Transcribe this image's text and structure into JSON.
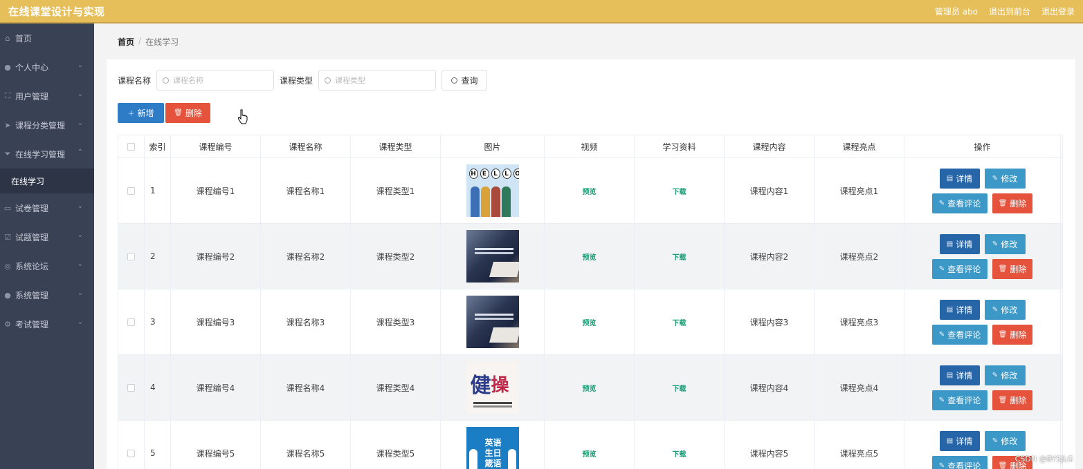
{
  "header": {
    "title": "在线课堂设计与实现",
    "admin": "管理员 abo",
    "back_front": "退出到前台",
    "logout": "退出登录"
  },
  "sidebar": {
    "items": [
      {
        "label": "首页",
        "icon": "home-icon"
      },
      {
        "label": "个人中心",
        "icon": "user-icon"
      },
      {
        "label": "用户管理",
        "icon": "frame-icon"
      },
      {
        "label": "课程分类管理",
        "icon": "send-icon"
      },
      {
        "label": "在线学习管理",
        "icon": "funnel-icon"
      },
      {
        "label": "试卷管理",
        "icon": "message-icon"
      },
      {
        "label": "试题管理",
        "icon": "check-box-icon"
      },
      {
        "label": "系统论坛",
        "icon": "compass-icon"
      },
      {
        "label": "系统管理",
        "icon": "user-icon"
      },
      {
        "label": "考试管理",
        "icon": "gear-icon"
      }
    ],
    "sub_item": "在线学习"
  },
  "breadcrumb": {
    "home": "首页",
    "sep": "/",
    "current": "在线学习"
  },
  "search": {
    "name_label": "课程名称",
    "name_placeholder": "课程名称",
    "type_label": "课程类型",
    "type_placeholder": "课程类型",
    "query_button": "查询"
  },
  "actions": {
    "add": "新增",
    "delete": "删除"
  },
  "table": {
    "headers": [
      "索引",
      "课程编号",
      "课程名称",
      "课程类型",
      "图片",
      "视频",
      "学习资料",
      "课程内容",
      "课程亮点",
      "操作"
    ],
    "rows": [
      {
        "index": "1",
        "code": "课程编号1",
        "name": "课程名称1",
        "type": "课程类型1",
        "video": "预览",
        "material": "下载",
        "content": "课程内容1",
        "highlight": "课程亮点1"
      },
      {
        "index": "2",
        "code": "课程编号2",
        "name": "课程名称2",
        "type": "课程类型2",
        "video": "预览",
        "material": "下载",
        "content": "课程内容2",
        "highlight": "课程亮点2"
      },
      {
        "index": "3",
        "code": "课程编号3",
        "name": "课程名称3",
        "type": "课程类型3",
        "video": "预览",
        "material": "下载",
        "content": "课程内容3",
        "highlight": "课程亮点3"
      },
      {
        "index": "4",
        "code": "课程编号4",
        "name": "课程名称4",
        "type": "课程类型4",
        "video": "预览",
        "material": "下载",
        "content": "课程内容4",
        "highlight": "课程亮点4"
      },
      {
        "index": "5",
        "code": "课程编号5",
        "name": "课程名称5",
        "type": "课程类型5",
        "video": "预览",
        "material": "下载",
        "content": "课程内容5",
        "highlight": "课程亮点5"
      }
    ],
    "ops": {
      "detail": "详情",
      "edit": "修改",
      "review": "查看评论",
      "remove": "删除"
    }
  },
  "thumbs": {
    "hello": [
      "H",
      "E",
      "L",
      "L",
      "O"
    ],
    "jian": [
      "健",
      "操"
    ],
    "eng": "英语 生日 箴语"
  },
  "watermark": "CSDN @BYSJLG",
  "colors": {
    "topbar": "#e7bf5a",
    "sidebar": "#394155",
    "primary": "#2f7cc6",
    "danger": "#e5533d",
    "info": "#3b98c7",
    "link": "#1a9b73"
  }
}
